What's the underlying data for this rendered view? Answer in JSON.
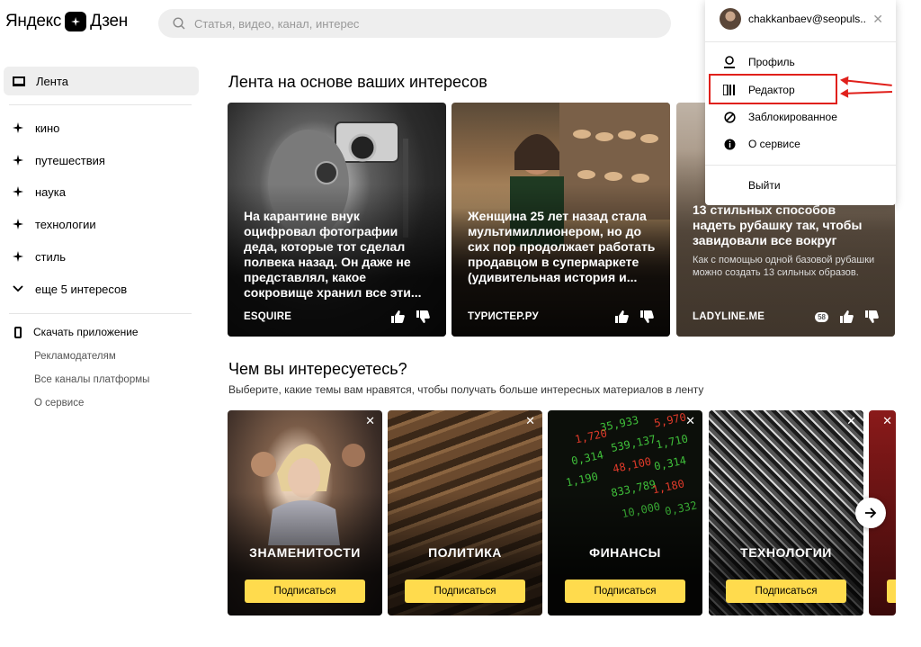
{
  "header": {
    "logo_left": "Яндекс",
    "logo_right": "Дзен",
    "search_placeholder": "Статья, видео, канал, интерес"
  },
  "sidebar": {
    "feed_label": "Лента",
    "interests": [
      "кино",
      "путешествия",
      "наука",
      "технологии",
      "стиль"
    ],
    "more_label": "еще 5 интересов",
    "app_label": "Скачать приложение",
    "links": [
      "Рекламодателям",
      "Все каналы платформы",
      "О сервисе"
    ]
  },
  "feed": {
    "heading": "Лента на основе ваших интересов",
    "cards": [
      {
        "title": "На карантине внук оцифровал фотографии деда, которые тот сделал полвека назад. Он даже не представлял, какое сокровище хранил все эти...",
        "source": "ESQUIRE"
      },
      {
        "title": "Женщина 25 лет назад стала мультимиллионером, но до сих пор продолжает работать продавцом в супермаркете (удивительная история и...",
        "source": "ТУРИСТЕР.РУ"
      },
      {
        "title": "13 стильных способов надеть рубашку так, чтобы завидовали все вокруг",
        "desc": "Как с помощью одной базовой рубашки можно создать 13 сильных образов.",
        "source": "LADYLINE.ME",
        "badge": "58"
      }
    ]
  },
  "interests": {
    "heading": "Чем вы интересуетесь?",
    "subtitle": "Выберите, какие темы вам нравятся, чтобы получать больше интересных материалов в ленту",
    "subscribe_label": "Подписаться",
    "topics": [
      "ЗНАМЕНИТОСТИ",
      "ПОЛИТИКА",
      "ФИНАНСЫ",
      "ТЕХНОЛОГИИ"
    ],
    "finance_numbers": [
      "35,933",
      "5,970",
      "539,137",
      "1,710",
      "48,100",
      "0,314",
      "833,789",
      "1,180",
      "10,000",
      "0,332",
      "1,720",
      "0,314",
      "1,190"
    ]
  },
  "menu": {
    "email": "chakkanbaev@seopuls...",
    "items": [
      "Профиль",
      "Редактор",
      "Заблокированное",
      "О сервисе"
    ],
    "logout": "Выйти"
  },
  "colors": {
    "accent": "#ffdb4d",
    "highlight": "#e0201b"
  }
}
